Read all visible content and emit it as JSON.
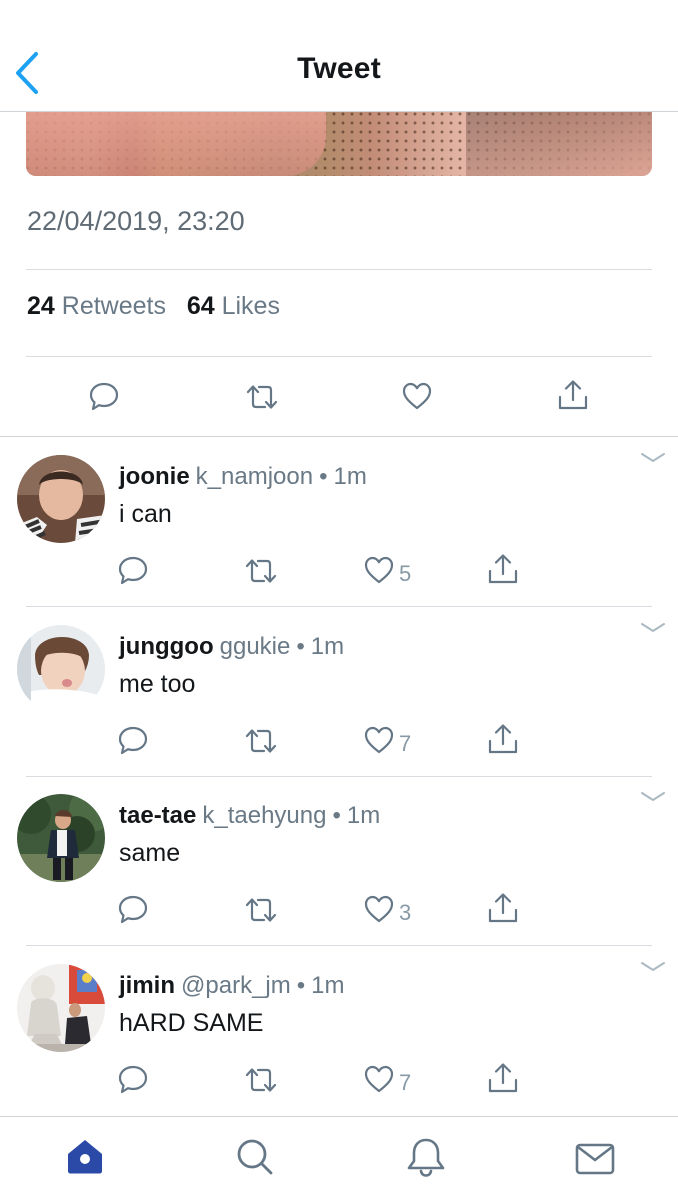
{
  "header": {
    "title": "Tweet",
    "back_icon": "chevron-left-icon",
    "accent_color": "#1da1f2"
  },
  "tweet": {
    "timestamp": "22/04/2019, 23:20",
    "retweets_count": "24",
    "retweets_label": "Retweets",
    "likes_count": "64",
    "likes_label": "Likes",
    "actions": [
      "reply-icon",
      "retweet-icon",
      "like-icon",
      "share-icon"
    ]
  },
  "replies": [
    {
      "name": "joonie",
      "handle": "k_namjoon",
      "dot": "•",
      "time": "1m",
      "text": "i can",
      "likes": "5"
    },
    {
      "name": "junggoo",
      "handle": "ggukie",
      "dot": "•",
      "time": "1m",
      "text": "me too",
      "likes": "7"
    },
    {
      "name": "tae-tae",
      "handle": "k_taehyung",
      "dot": "•",
      "time": "1m",
      "text": "same",
      "likes": "3"
    },
    {
      "name": "jimin",
      "handle": "@park_jm",
      "dot": "•",
      "time": "1m",
      "text": "hARD SAME",
      "likes": "7"
    }
  ],
  "tabbar": {
    "items": [
      "home-icon",
      "search-icon",
      "notifications-icon",
      "messages-icon"
    ],
    "active_color": "#2b4aa8",
    "inactive_color": "#8899a6"
  }
}
